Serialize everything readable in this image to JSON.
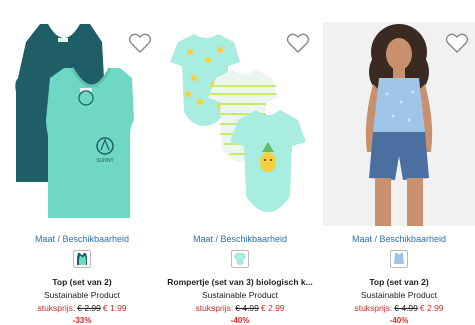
{
  "products": [
    {
      "availability_link": "Maat / Beschikbaarheid",
      "swatch_icon": "tank-top-swatch-icon",
      "title": "Top (set van 2)",
      "subtitle": "Sustainable Product",
      "price_label": "stuksprijs:",
      "old_price": "€ 2.99",
      "new_price": "€ 1.99",
      "discount": "-33%"
    },
    {
      "availability_link": "Maat / Beschikbaarheid",
      "swatch_icon": "romper-swatch-icon",
      "title": "Rompertje (set van 3) biologisch k...",
      "subtitle": "Sustainable Product",
      "price_label": "stuksprijs:",
      "old_price": "€ 4.99",
      "new_price": "€ 2.99",
      "discount": "-40%"
    },
    {
      "availability_link": "Maat / Beschikbaarheid",
      "swatch_icon": "top-swatch-icon",
      "title": "Top (set van 2)",
      "subtitle": "Sustainable Product",
      "price_label": "stuksprijs:",
      "old_price": "€ 4.99",
      "new_price": "€ 2.99",
      "discount": "-40%"
    }
  ],
  "colors": {
    "link": "#2f6fb3",
    "sale": "#d12a2a",
    "tank_dark": "#1f5e66",
    "tank_mint": "#6fd8c4",
    "romper_mint": "#a9ece0"
  }
}
